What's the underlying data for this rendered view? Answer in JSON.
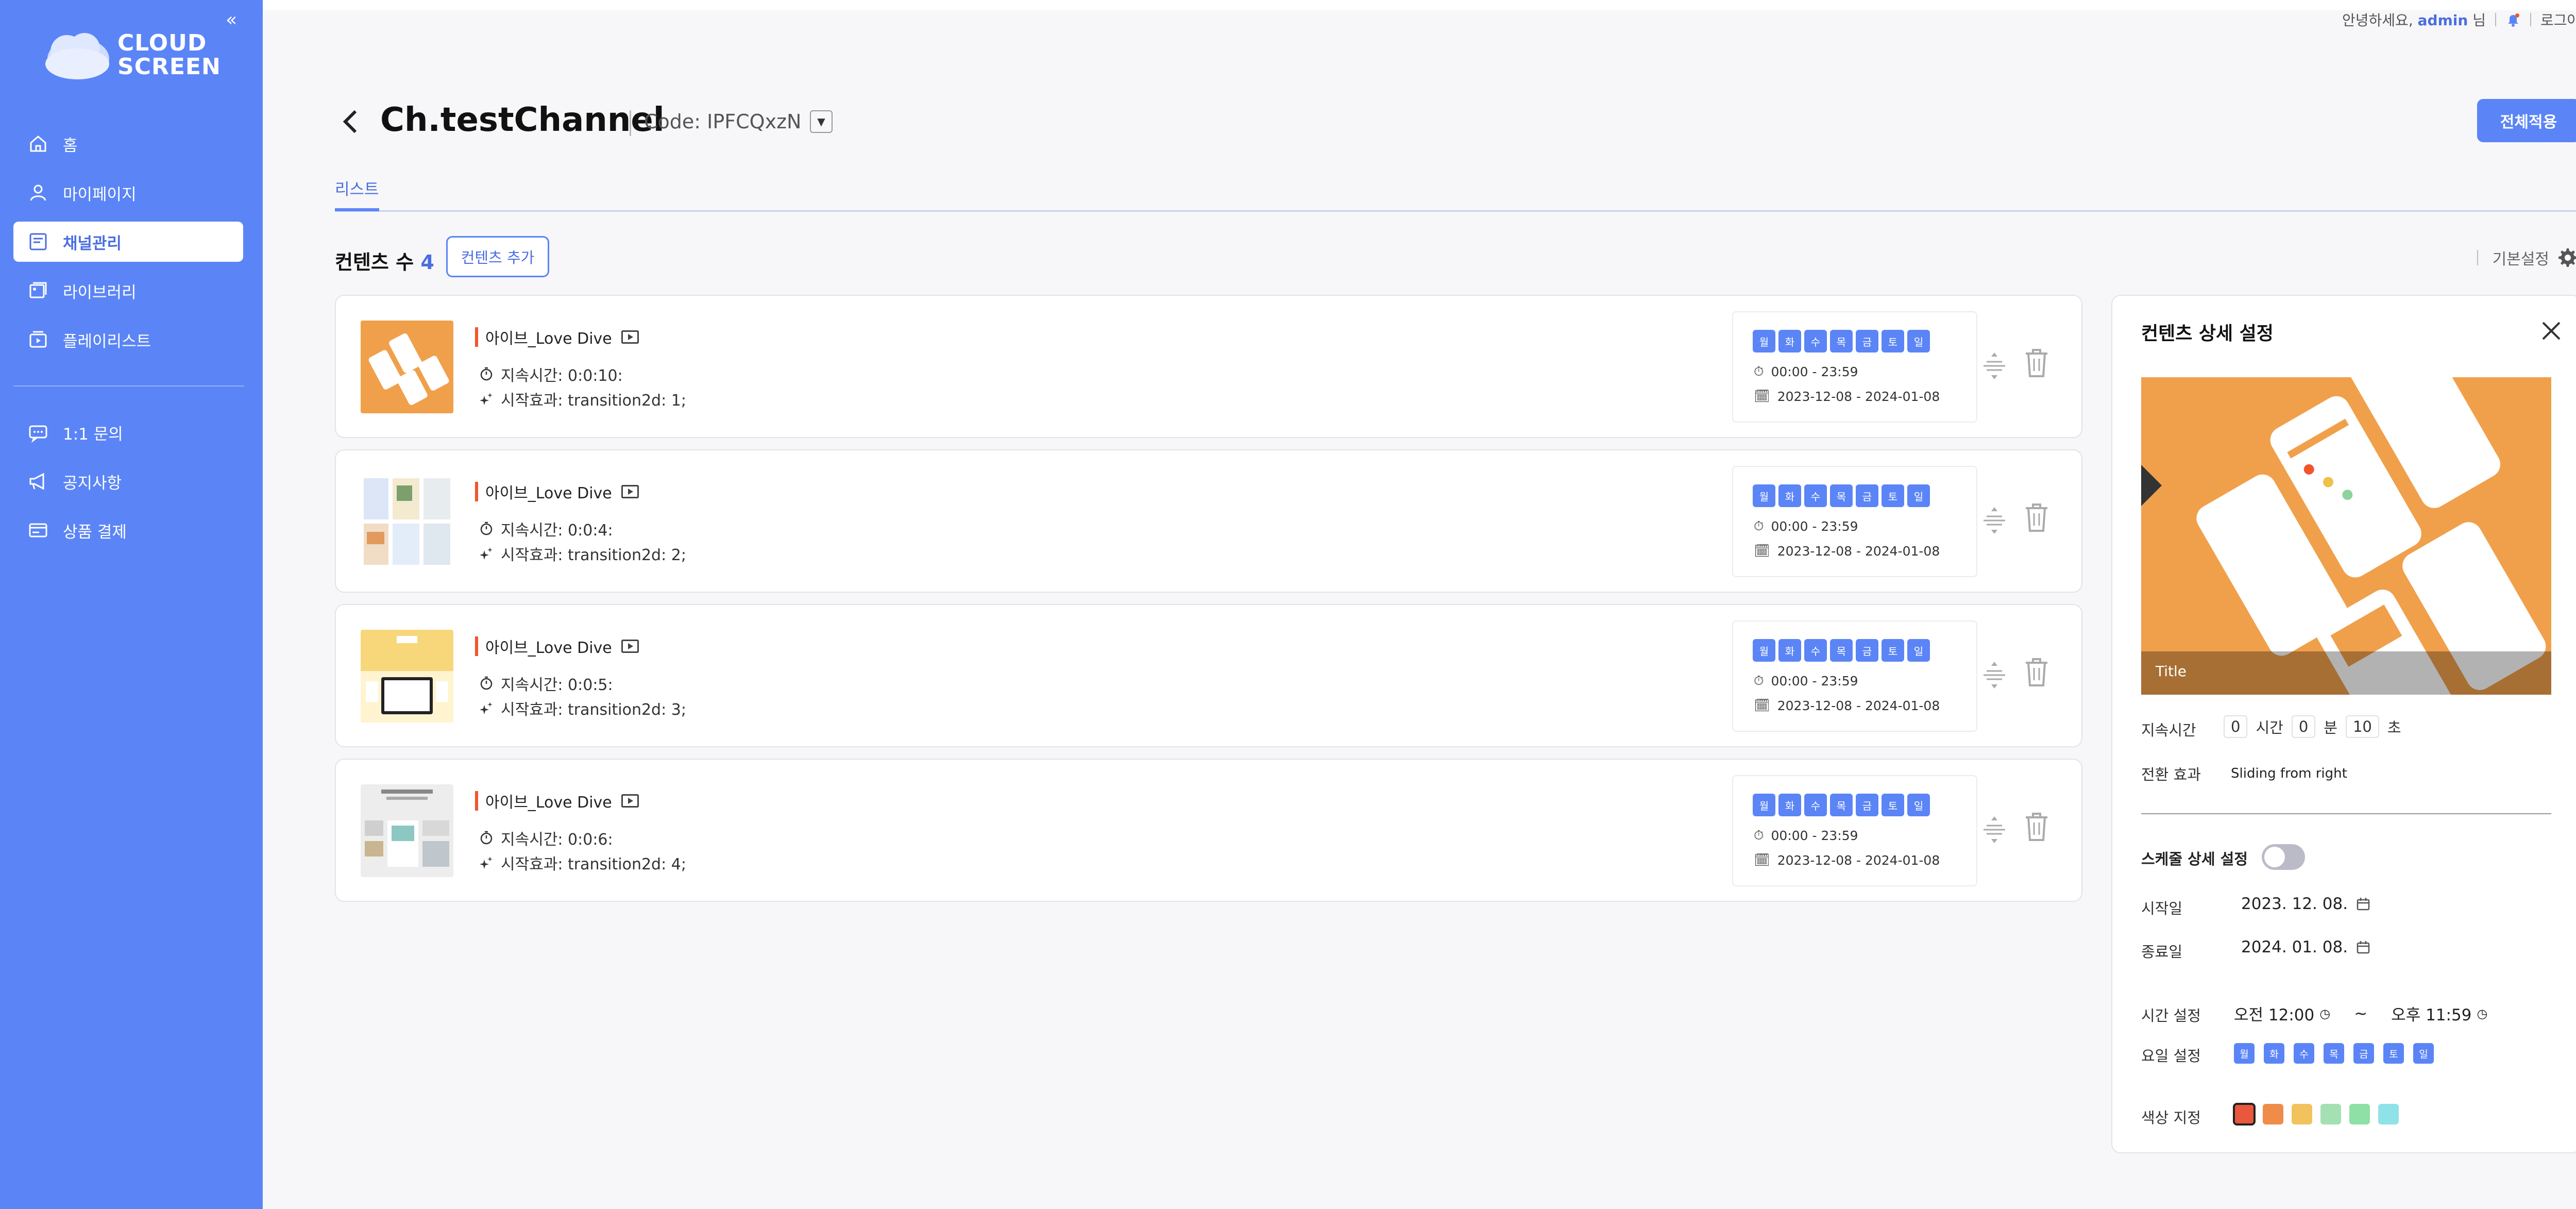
{
  "brand": {
    "line1": "CLOUD",
    "line2": "SCREEN"
  },
  "sidebar": {
    "collapse": "«",
    "items": [
      {
        "label": "홈",
        "icon": "home-icon"
      },
      {
        "label": "마이페이지",
        "icon": "user-icon"
      },
      {
        "label": "채널관리",
        "icon": "channel-icon",
        "active": true
      },
      {
        "label": "라이브러리",
        "icon": "library-icon"
      },
      {
        "label": "플레이리스트",
        "icon": "playlist-icon"
      }
    ],
    "items2": [
      {
        "label": "1:1 문의",
        "icon": "chat-icon"
      },
      {
        "label": "공지사항",
        "icon": "megaphone-icon"
      },
      {
        "label": "상품 결제",
        "icon": "payment-icon"
      }
    ]
  },
  "topbar": {
    "greeting": "안녕하세요,",
    "user": "admin",
    "suffix": "님",
    "logout": "로그아웃"
  },
  "header": {
    "title": "Ch.testChannel",
    "code": "Code: IPFCQxzN",
    "apply_all": "전체적용"
  },
  "tabs": [
    {
      "label": "리스트"
    }
  ],
  "list": {
    "count_label": "컨텐츠 수",
    "count": "4",
    "add_button": "컨텐츠 추가",
    "basic_settings": "기본설정"
  },
  "day_labels": [
    "월",
    "화",
    "수",
    "목",
    "금",
    "토",
    "일"
  ],
  "contents": [
    {
      "title": "아이브_Love Dive",
      "duration": "지속시간: 0:0:10:",
      "effect": "시작효과: transition2d: 1;",
      "time": "00:00 - 23:59",
      "dates": "2023-12-08 - 2024-01-08"
    },
    {
      "title": "아이브_Love Dive",
      "duration": "지속시간: 0:0:4:",
      "effect": "시작효과: transition2d: 2;",
      "time": "00:00 - 23:59",
      "dates": "2023-12-08 - 2024-01-08"
    },
    {
      "title": "아이브_Love Dive",
      "duration": "지속시간: 0:0:5:",
      "effect": "시작효과: transition2d: 3;",
      "time": "00:00 - 23:59",
      "dates": "2023-12-08 - 2024-01-08"
    },
    {
      "title": "아이브_Love Dive",
      "duration": "지속시간: 0:0:6:",
      "effect": "시작효과: transition2d: 4;",
      "time": "00:00 - 23:59",
      "dates": "2023-12-08 - 2024-01-08"
    }
  ],
  "detail": {
    "title": "컨텐츠 상세 설정",
    "preview_caption": "Title",
    "duration_label": "지속시간",
    "hours": "0",
    "hours_unit": "시간",
    "minutes": "0",
    "minutes_unit": "분",
    "seconds": "10",
    "seconds_unit": "초",
    "transition_label": "전환 효과",
    "transition_value": "Sliding from right",
    "schedule_label": "스케줄 상세 설정",
    "schedule_enabled": false,
    "start_label": "시작일",
    "start_value": "2023. 12. 08.",
    "end_label": "종료일",
    "end_value": "2024. 01. 08.",
    "time_label": "시간 설정",
    "time_start": "오전 12:00",
    "time_sep": "~",
    "time_end": "오후 11:59",
    "days_label": "요일 설정",
    "color_label": "색상 지정",
    "colors": [
      "#e9573c",
      "#ef8c4a",
      "#f2c35c",
      "#a5e0b3",
      "#8ee0a6",
      "#8fe3e8"
    ],
    "selected_color": 0
  }
}
